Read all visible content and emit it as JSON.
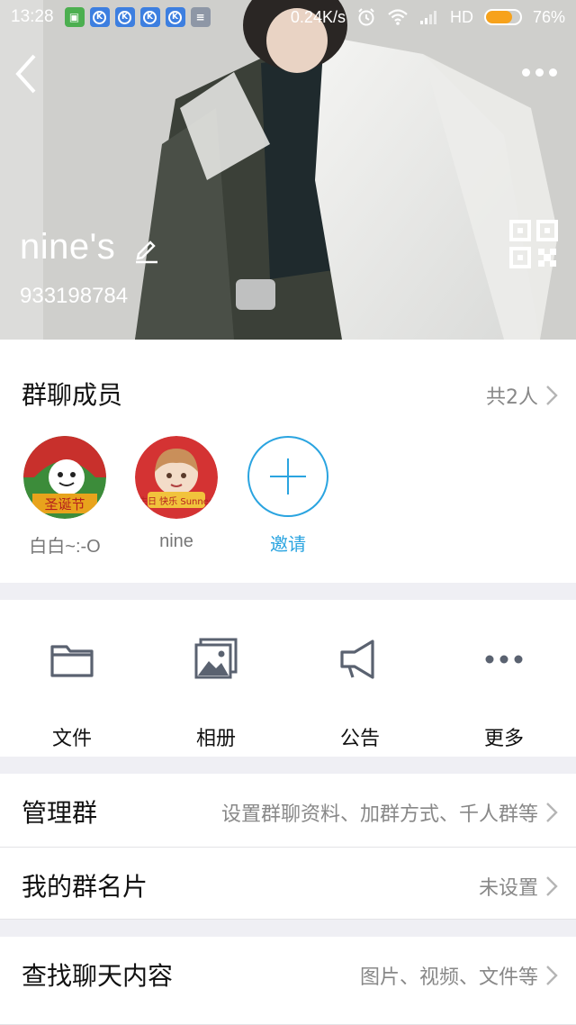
{
  "status_bar": {
    "time": "13:28",
    "net_speed": "0.24K/s",
    "network": "HD",
    "battery": "76%",
    "battery_level": 0.76,
    "app_icons": [
      "shield-icon",
      "k-app-icon",
      "k-app-icon",
      "k-app-icon",
      "k-app-icon",
      "notes-app-icon"
    ]
  },
  "header": {
    "group_name": "nine's",
    "group_id": "933198784"
  },
  "members": {
    "title": "群聊成员",
    "count_label": "共2人",
    "list": [
      {
        "name": "白白~:-O",
        "avatar_text": "圣诞节"
      },
      {
        "name": "nine",
        "avatar_text": "生日 快乐 Sunnee"
      }
    ],
    "invite_label": "邀请"
  },
  "functions": [
    {
      "label": "文件",
      "icon": "folder-icon"
    },
    {
      "label": "相册",
      "icon": "album-icon"
    },
    {
      "label": "公告",
      "icon": "megaphone-icon"
    },
    {
      "label": "更多",
      "icon": "more-dots-icon"
    }
  ],
  "settings": [
    {
      "title": "管理群",
      "detail": "设置群聊资料、加群方式、千人群等"
    },
    {
      "title": "我的群名片",
      "detail": "未设置"
    },
    {
      "title": "查找聊天内容",
      "detail": "图片、视频、文件等"
    }
  ],
  "colors": {
    "accent": "#2aa4e0",
    "battery": "#f7a21b",
    "divider_bg": "#efeff4"
  }
}
